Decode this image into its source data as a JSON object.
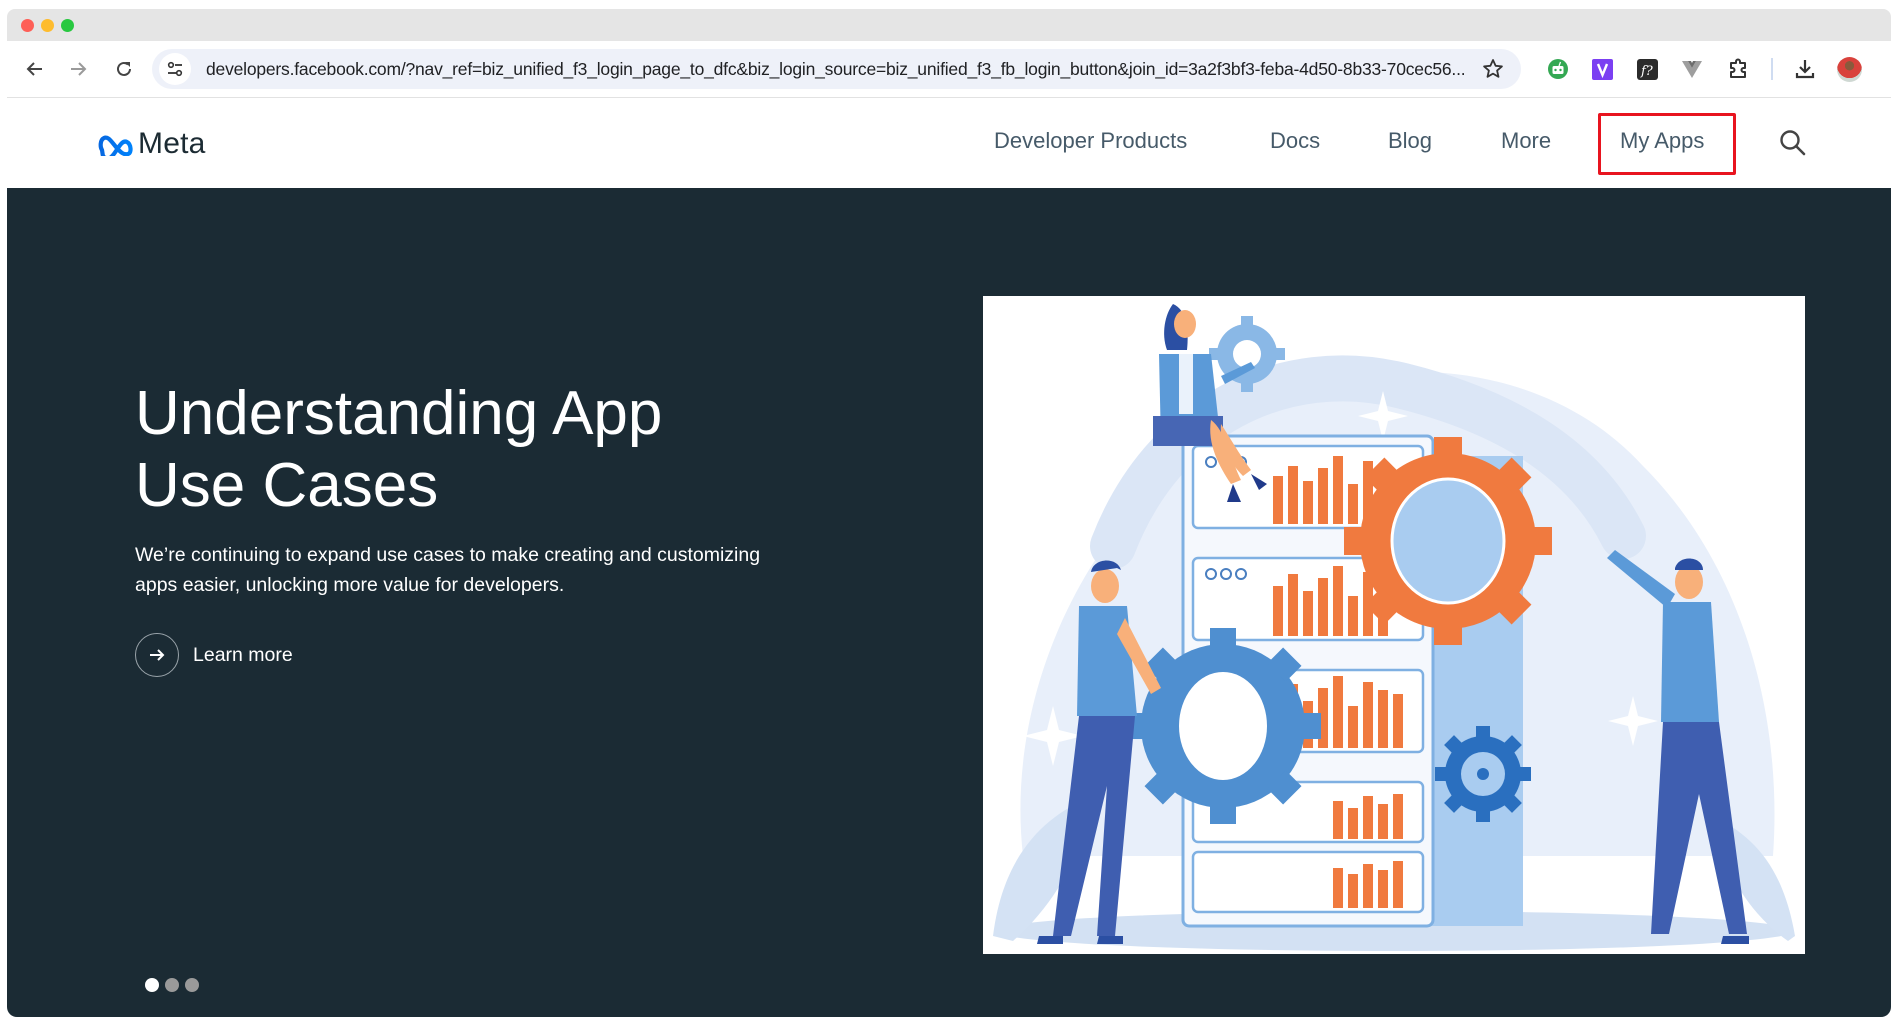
{
  "browser": {
    "url": "developers.facebook.com/?nav_ref=biz_unified_f3_login_page_to_dfc&biz_login_source=biz_unified_f3_fb_login_button&join_id=3a2f3bf3-feba-4d50-8b33-70cec56...",
    "extensions": [
      "robot-extension-icon",
      "v-extension-icon",
      "f-question-extension-icon",
      "vue-devtools-icon",
      "puzzle-extensions-icon"
    ],
    "colors": {
      "accent": "#e8141f",
      "hero_bg": "#1b2b34",
      "nav_text": "#465a69",
      "meta_blue": "#0866ff"
    }
  },
  "site": {
    "logo_text": "Meta",
    "nav": [
      {
        "label": "Developer Products"
      },
      {
        "label": "Docs"
      },
      {
        "label": "Blog"
      },
      {
        "label": "More"
      },
      {
        "label": "My Apps",
        "highlighted": true
      }
    ]
  },
  "hero": {
    "title": "Understanding App Use Cases",
    "description": "We’re continuing to expand use cases to make creating and customizing apps easier, unlocking more value for developers.",
    "cta_label": "Learn more",
    "carousel": {
      "total": 3,
      "active": 1
    }
  }
}
